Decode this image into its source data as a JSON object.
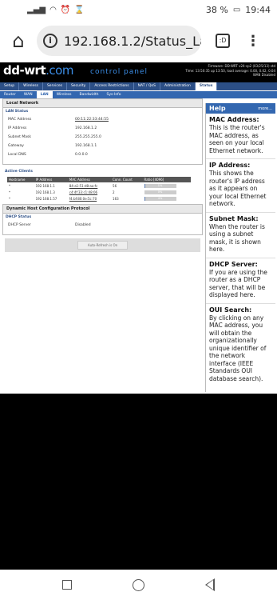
{
  "statusbar": {
    "battery": "38 %",
    "time": "19:44"
  },
  "browser": {
    "url": "192.168.1.2/Status_La",
    "tabs_count": ":D"
  },
  "ddwrt": {
    "logo_main": "dd-wrt",
    "logo_suffix": ".com",
    "control_panel": "control panel",
    "fw_line1": "Firmware: DD-WRT v24-sp2 (03/25/13) std",
    "fw_line2": "Time: 13:50:35 up 13:50, load average: 0.00, 0.02, 0.04",
    "fw_line3": "WAN Disabled",
    "main_tabs": [
      "Setup",
      "Wireless",
      "Services",
      "Security",
      "Access Restrictions",
      "NAT / QoS",
      "Administration",
      "Status"
    ],
    "sub_tabs": [
      "Router",
      "WAN",
      "LAN",
      "Wireless",
      "Bandwidth",
      "Sys-Info"
    ]
  },
  "local_network": {
    "section_title": "Local Network",
    "lan_status_title": "LAN Status",
    "rows": [
      {
        "label": "MAC Address",
        "value": "00:11:22:33:44:55"
      },
      {
        "label": "IP Address",
        "value": "192.168.1.2"
      },
      {
        "label": "Subnet Mask",
        "value": "255.255.255.0"
      },
      {
        "label": "Gateway",
        "value": "192.168.1.1"
      },
      {
        "label": "Local DNS",
        "value": "0.0.0.0"
      }
    ]
  },
  "active_clients": {
    "title": "Active Clients",
    "headers": [
      "Hostname",
      "IP Address",
      "MAC Address",
      "Conn. Count",
      "Ratio [4096]"
    ],
    "rows": [
      {
        "hostname": "*",
        "ip": "192.168.1.1",
        "mac": "84:a1:51:d8:aa:fc",
        "count": "56",
        "ratio_text": "1%",
        "ratio": 1
      },
      {
        "hostname": "*",
        "ip": "192.168.1.3",
        "mac": "c4:4f:33:c1:48:06",
        "count": "2",
        "ratio_text": "0%",
        "ratio": 0
      },
      {
        "hostname": "*",
        "ip": "192.168.1.57",
        "mac": "f4:bf:80:0e:5c:70",
        "count": "163",
        "ratio_text": "4%",
        "ratio": 4
      }
    ]
  },
  "dhcp": {
    "section_title": "Dynamic Host Configuration Protocol",
    "status_title": "DHCP Status",
    "server_label": "DHCP Server",
    "server_value": "Disabled"
  },
  "auto_refresh_label": "Auto-Refresh is On",
  "help": {
    "title": "Help",
    "more": "more...",
    "items": [
      {
        "title": "MAC Address:",
        "text": "This is the router's MAC address, as seen on your local Ethernet network."
      },
      {
        "title": "IP Address:",
        "text": "This shows the router's IP address as it appears on your local Ethernet network."
      },
      {
        "title": "Subnet Mask:",
        "text": "When the router is using a subnet mask, it is shown here."
      },
      {
        "title": "DHCP Server:",
        "text": "If you are using the router as a DHCP server, that will be displayed here."
      },
      {
        "title": "OUI Search:",
        "text": "By clicking on any MAC address, you will obtain the organizationally unique identifier of the network interface (IEEE Standards OUI database search)."
      }
    ]
  }
}
